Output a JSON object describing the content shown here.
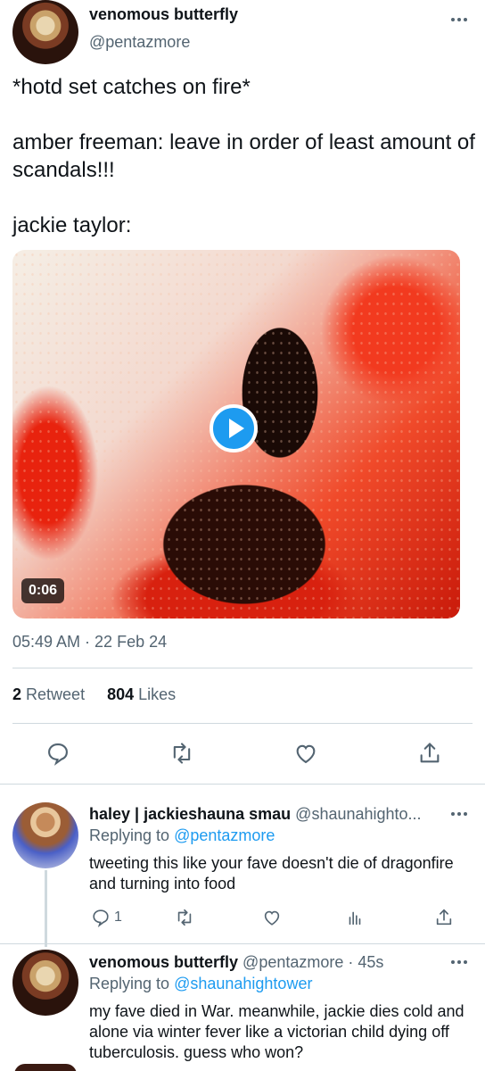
{
  "main_tweet": {
    "author_name": "venomous butterfly",
    "author_handle": "@pentazmore",
    "text_lines": [
      "*hotd set catches on fire*",
      "amber freeman: leave in order of least amount of scandals!!!",
      "jackie taylor:"
    ],
    "video_duration": "0:06",
    "timestamp": "05:49 AM · 22 Feb 24",
    "retweet_count": "2",
    "retweet_label": "Retweet",
    "like_count": "804",
    "like_label": "Likes",
    "icons": [
      "reply-icon",
      "retweet-icon",
      "like-icon",
      "share-icon"
    ]
  },
  "replies": [
    {
      "author_name": "haley | jackieshauna smau",
      "author_handle": "@shaunahighto...",
      "replying_prefix": "Replying to",
      "replying_to": "@pentazmore",
      "text": "tweeting this like your fave doesn't die of dragonfire and turning into food",
      "reply_count": "1"
    },
    {
      "author_name": "venomous butterfly",
      "author_handle": "@pentazmore",
      "time": "· 45s",
      "replying_prefix": "Replying to",
      "replying_to": "@shaunahightower",
      "text": "my fave died in War. meanwhile, jackie dies cold and alone via winter fever like a victorian child dying off tuberculosis. guess who won?"
    }
  ],
  "colors": {
    "accent": "#1d9bf0",
    "text": "#0f1419",
    "secondary": "#536471",
    "divider": "#cfd9de"
  }
}
